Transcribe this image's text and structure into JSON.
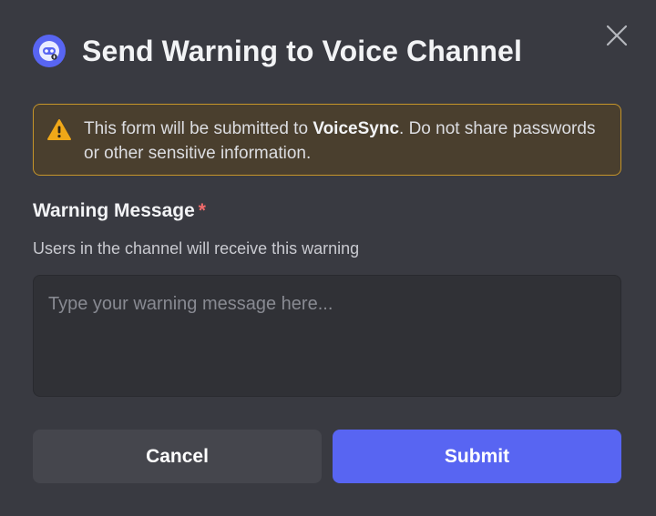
{
  "modal": {
    "title": "Send Warning to Voice Channel",
    "icons": {
      "bot": "bot-avatar-icon",
      "close": "close-icon",
      "warning": "warning-triangle-icon"
    }
  },
  "notice": {
    "prefix": "This form will be submitted to ",
    "app_name": "VoiceSync",
    "suffix": ". Do not share passwords or other sensitive information."
  },
  "field": {
    "label": "Warning Message",
    "required_mark": "*",
    "description": "Users in the channel will receive this warning",
    "placeholder": "Type your warning message here...",
    "value": ""
  },
  "buttons": {
    "cancel": "Cancel",
    "submit": "Submit"
  },
  "colors": {
    "background": "#393a41",
    "accent": "#5865f2",
    "warning_border": "#c6952a",
    "warning_bg": "#4a3f2e",
    "required": "#f26b6b"
  }
}
